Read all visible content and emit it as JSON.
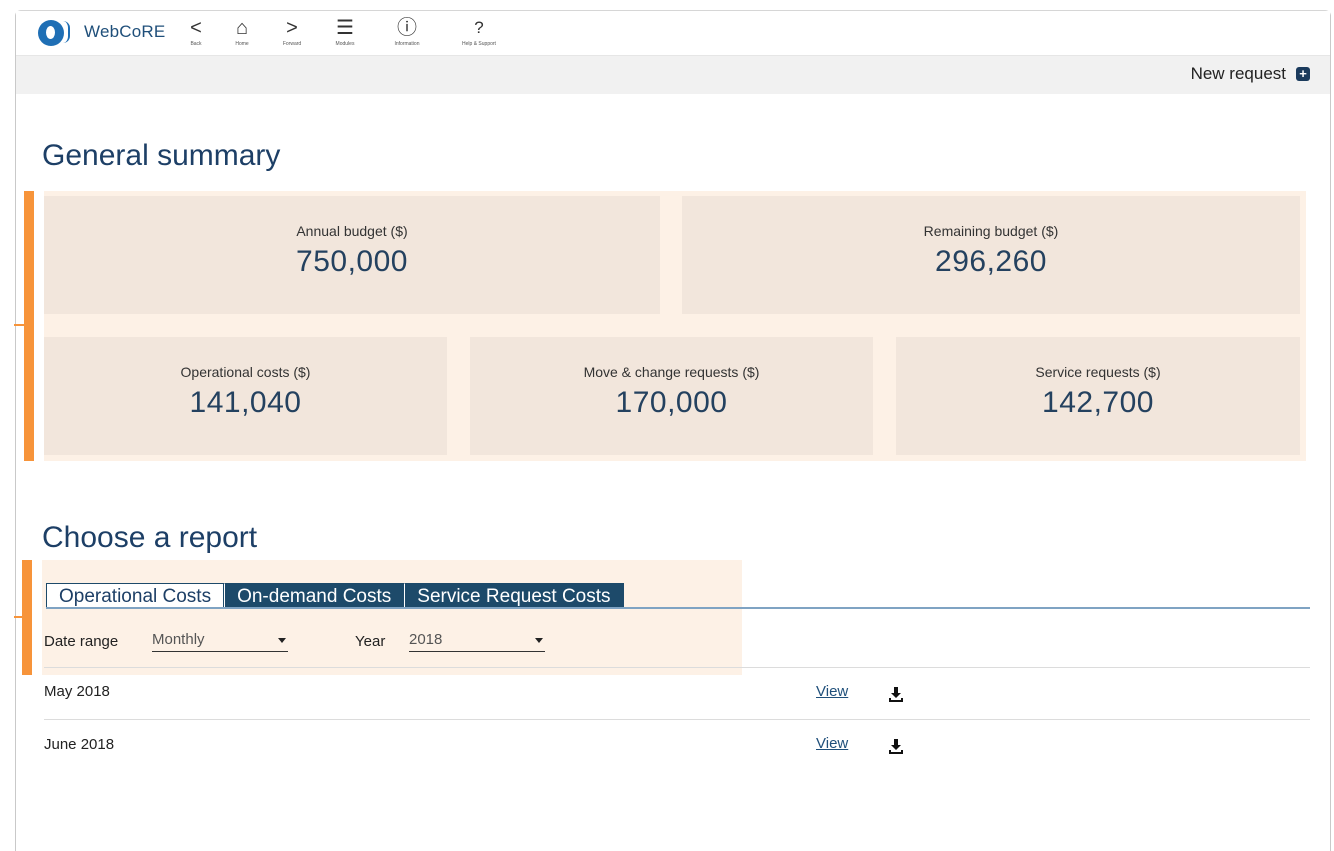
{
  "app": {
    "title": "WebCoRE"
  },
  "toolbar": {
    "buttons": [
      {
        "label": "Back",
        "icon": "chevron-left-icon",
        "glyph": "<"
      },
      {
        "label": "Home",
        "icon": "home-icon",
        "glyph": "⌂"
      },
      {
        "label": "Forward",
        "icon": "chevron-right-icon",
        "glyph": ">"
      },
      {
        "label": "Modules",
        "icon": "menu-icon",
        "glyph": "☰"
      },
      {
        "label": "Information",
        "icon": "info-icon",
        "glyph": "ⓘ"
      },
      {
        "label": "Help & Support",
        "icon": "help-icon",
        "glyph": "?"
      }
    ]
  },
  "header": {
    "new_request_label": "New request",
    "new_request_icon": "plus-square-icon"
  },
  "summary": {
    "title": "General summary",
    "cards": [
      {
        "label": "Annual budget ($)",
        "value": "750,000"
      },
      {
        "label": "Remaining budget ($)",
        "value": "296,260"
      },
      {
        "label": "Operational costs ($)",
        "value": "141,040"
      },
      {
        "label": "Move & change requests ($)",
        "value": "170,000"
      },
      {
        "label": "Service requests ($)",
        "value": "142,700"
      }
    ]
  },
  "report": {
    "title": "Choose a report",
    "tabs": [
      {
        "label": "Operational Costs",
        "active": true
      },
      {
        "label": "On-demand Costs",
        "active": false
      },
      {
        "label": "Service Request Costs",
        "active": false
      }
    ],
    "filters": {
      "date_range_label": "Date range",
      "date_range_value": "Monthly",
      "year_label": "Year",
      "year_value": "2018"
    },
    "rows": [
      {
        "period": "May 2018",
        "view_label": "View",
        "download_icon": "download-icon"
      },
      {
        "period": "June 2018",
        "view_label": "View",
        "download_icon": "download-icon"
      }
    ]
  },
  "colors": {
    "accent_highlight": "#f7943a",
    "highlight_bg": "#fdf1e6",
    "card_bg": "#f2e6dc",
    "heading": "#1d3f66",
    "tab_dark": "#1d4a6a"
  }
}
